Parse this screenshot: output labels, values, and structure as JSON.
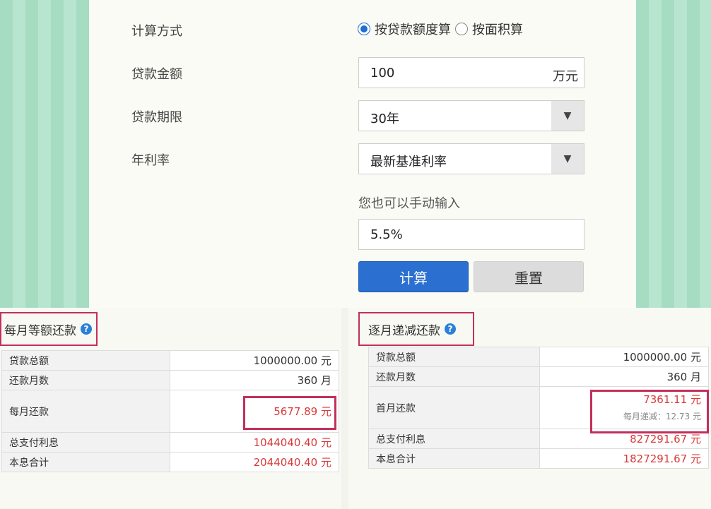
{
  "form": {
    "calc_method_label": "计算方式",
    "radio_options": [
      {
        "label": "按贷款额度算",
        "checked": true
      },
      {
        "label": "按面积算",
        "checked": false
      }
    ],
    "loan_amount_label": "贷款金额",
    "loan_amount_value": "100",
    "loan_amount_unit": "万元",
    "loan_term_label": "贷款期限",
    "loan_term_value": "30年",
    "rate_label": "年利率",
    "rate_value": "最新基准利率",
    "manual_hint": "您也可以手动输入",
    "manual_rate_value": "5.5%",
    "calc_button": "计算",
    "reset_button": "重置"
  },
  "equal_payment": {
    "title": "每月等额还款",
    "rows": [
      {
        "label": "贷款总额",
        "value": "1000000.00 元",
        "red": false
      },
      {
        "label": "还款月数",
        "value": "360 月",
        "red": false
      },
      {
        "label": "每月还款",
        "value": "5677.89 元",
        "red": true
      },
      {
        "label": "总支付利息",
        "value": "1044040.40 元",
        "red": true
      },
      {
        "label": "本息合计",
        "value": "2044040.40 元",
        "red": true
      }
    ]
  },
  "decreasing_payment": {
    "title": "逐月递减还款",
    "rows": [
      {
        "label": "贷款总额",
        "value": "1000000.00 元",
        "red": false
      },
      {
        "label": "还款月数",
        "value": "360 月",
        "red": false
      },
      {
        "label": "首月还款",
        "value": "7361.11 元",
        "red": true,
        "note": "每月递减：12.73 元"
      },
      {
        "label": "总支付利息",
        "value": "827291.67 元",
        "red": true
      },
      {
        "label": "本息合计",
        "value": "1827291.67 元",
        "red": true
      }
    ]
  },
  "icons": {
    "help": "question-circle-icon",
    "dropdown": "triangle-down-icon"
  },
  "colors": {
    "accent": "#2b6fd0",
    "highlight": "#c2305a",
    "red_value": "#d93a3a"
  }
}
